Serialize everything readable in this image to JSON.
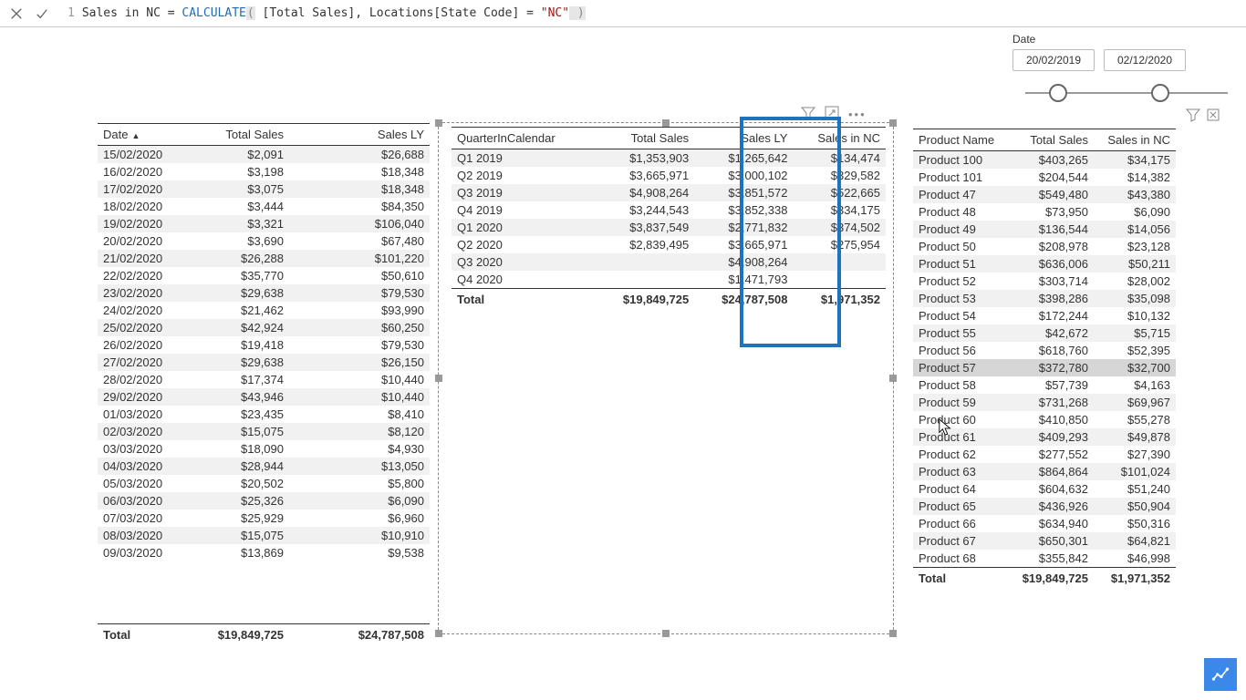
{
  "formula": {
    "line_no": "1",
    "prefix": "Sales in NC = ",
    "fn": "CALCULATE",
    "paren_open": "(",
    "arg_measure": " [Total Sales]",
    "sep1": ", ",
    "arg_col": "Locations[State Code]",
    "eq": " = ",
    "arg_str": "\"NC\"",
    "paren_close": " )"
  },
  "date_slicer": {
    "title": "Date",
    "start": "20/02/2019",
    "end": "02/12/2020"
  },
  "table_date": {
    "headers": [
      "Date",
      "Total Sales",
      "Sales LY"
    ],
    "rows": [
      [
        "15/02/2020",
        "$2,091",
        "$26,688"
      ],
      [
        "16/02/2020",
        "$3,198",
        "$18,348"
      ],
      [
        "17/02/2020",
        "$3,075",
        "$18,348"
      ],
      [
        "18/02/2020",
        "$3,444",
        "$84,350"
      ],
      [
        "19/02/2020",
        "$3,321",
        "$106,040"
      ],
      [
        "20/02/2020",
        "$3,690",
        "$67,480"
      ],
      [
        "21/02/2020",
        "$26,288",
        "$101,220"
      ],
      [
        "22/02/2020",
        "$35,770",
        "$50,610"
      ],
      [
        "23/02/2020",
        "$29,638",
        "$79,530"
      ],
      [
        "24/02/2020",
        "$21,462",
        "$93,990"
      ],
      [
        "25/02/2020",
        "$42,924",
        "$60,250"
      ],
      [
        "26/02/2020",
        "$19,418",
        "$79,530"
      ],
      [
        "27/02/2020",
        "$29,638",
        "$26,150"
      ],
      [
        "28/02/2020",
        "$17,374",
        "$10,440"
      ],
      [
        "29/02/2020",
        "$43,946",
        "$10,440"
      ],
      [
        "01/03/2020",
        "$23,435",
        "$8,410"
      ],
      [
        "02/03/2020",
        "$15,075",
        "$8,120"
      ],
      [
        "03/03/2020",
        "$18,090",
        "$4,930"
      ],
      [
        "04/03/2020",
        "$28,944",
        "$13,050"
      ],
      [
        "05/03/2020",
        "$20,502",
        "$5,800"
      ],
      [
        "06/03/2020",
        "$25,326",
        "$6,090"
      ],
      [
        "07/03/2020",
        "$25,929",
        "$6,960"
      ],
      [
        "08/03/2020",
        "$15,075",
        "$10,910"
      ],
      [
        "09/03/2020",
        "$13,869",
        "$9,538"
      ]
    ],
    "total": [
      "Total",
      "$19,849,725",
      "$24,787,508"
    ]
  },
  "table_quarter": {
    "headers": [
      "QuarterInCalendar",
      "Total Sales",
      "Sales LY",
      "Sales in NC"
    ],
    "rows": [
      [
        "Q1 2019",
        "$1,353,903",
        "$1,265,642",
        "$134,474"
      ],
      [
        "Q2 2019",
        "$3,665,971",
        "$3,000,102",
        "$329,582"
      ],
      [
        "Q3 2019",
        "$4,908,264",
        "$3,851,572",
        "$522,665"
      ],
      [
        "Q4 2019",
        "$3,244,543",
        "$3,852,338",
        "$334,175"
      ],
      [
        "Q1 2020",
        "$3,837,549",
        "$2,771,832",
        "$374,502"
      ],
      [
        "Q2 2020",
        "$2,839,495",
        "$3,665,971",
        "$275,954"
      ],
      [
        "Q3 2020",
        "",
        "$4,908,264",
        ""
      ],
      [
        "Q4 2020",
        "",
        "$1,471,793",
        ""
      ]
    ],
    "total": [
      "Total",
      "$19,849,725",
      "$24,787,508",
      "$1,971,352"
    ]
  },
  "table_product": {
    "headers": [
      "Product Name",
      "Total Sales",
      "Sales in NC"
    ],
    "rows": [
      [
        "Product 100",
        "$403,265",
        "$34,175"
      ],
      [
        "Product 101",
        "$204,544",
        "$14,382"
      ],
      [
        "Product 47",
        "$549,480",
        "$43,380"
      ],
      [
        "Product 48",
        "$73,950",
        "$6,090"
      ],
      [
        "Product 49",
        "$136,544",
        "$14,056"
      ],
      [
        "Product 50",
        "$208,978",
        "$23,128"
      ],
      [
        "Product 51",
        "$636,006",
        "$50,211"
      ],
      [
        "Product 52",
        "$303,714",
        "$28,002"
      ],
      [
        "Product 53",
        "$398,286",
        "$35,098"
      ],
      [
        "Product 54",
        "$172,244",
        "$10,132"
      ],
      [
        "Product 55",
        "$42,672",
        "$5,715"
      ],
      [
        "Product 56",
        "$618,760",
        "$52,395"
      ],
      [
        "Product 57",
        "$372,780",
        "$32,700"
      ],
      [
        "Product 58",
        "$57,739",
        "$4,163"
      ],
      [
        "Product 59",
        "$731,268",
        "$69,967"
      ],
      [
        "Product 60",
        "$410,850",
        "$55,278"
      ],
      [
        "Product 61",
        "$409,293",
        "$49,878"
      ],
      [
        "Product 62",
        "$277,552",
        "$27,390"
      ],
      [
        "Product 63",
        "$864,864",
        "$101,024"
      ],
      [
        "Product 64",
        "$604,632",
        "$51,240"
      ],
      [
        "Product 65",
        "$436,926",
        "$50,904"
      ],
      [
        "Product 66",
        "$634,940",
        "$50,316"
      ],
      [
        "Product 67",
        "$650,301",
        "$64,821"
      ],
      [
        "Product 68",
        "$355,842",
        "$46,998"
      ]
    ],
    "total": [
      "Total",
      "$19,849,725",
      "$1,971,352"
    ],
    "hover_index": 12
  }
}
